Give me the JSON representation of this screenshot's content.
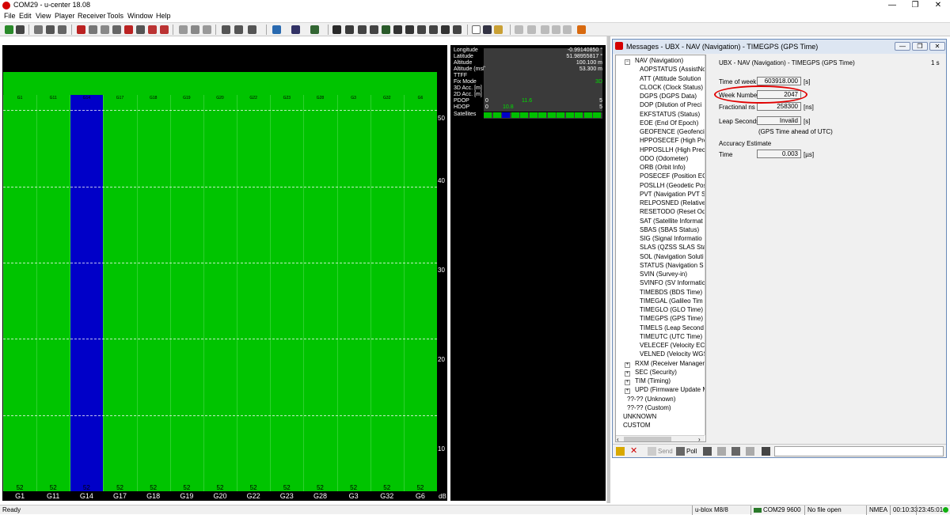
{
  "window": {
    "title": "COM29 - u-center 18.08",
    "minimize": "—",
    "restore": "❐",
    "close": "✕"
  },
  "menu": [
    "File",
    "Edit",
    "View",
    "Player",
    "Receiver",
    "Tools",
    "Window",
    "Help"
  ],
  "signal_chart": {
    "y_ticks": [
      "50",
      "40",
      "30",
      "20",
      "10"
    ],
    "unit": "dB",
    "satellites": [
      {
        "name": "G1",
        "cno": 52,
        "selected": false
      },
      {
        "name": "G11",
        "cno": 52,
        "selected": false
      },
      {
        "name": "G14",
        "cno": 52,
        "selected": true
      },
      {
        "name": "G17",
        "cno": 52,
        "selected": false
      },
      {
        "name": "G18",
        "cno": 52,
        "selected": false
      },
      {
        "name": "G19",
        "cno": 52,
        "selected": false
      },
      {
        "name": "G20",
        "cno": 52,
        "selected": false
      },
      {
        "name": "G22",
        "cno": 52,
        "selected": false
      },
      {
        "name": "G23",
        "cno": 52,
        "selected": false
      },
      {
        "name": "G28",
        "cno": 52,
        "selected": false
      },
      {
        "name": "G3",
        "cno": 52,
        "selected": false
      },
      {
        "name": "G32",
        "cno": 52,
        "selected": false
      },
      {
        "name": "G6",
        "cno": 52,
        "selected": false
      }
    ],
    "colors": {
      "bar": "#00c400",
      "selected_bar": "#0000c8",
      "background": "#000000"
    }
  },
  "data_panel": {
    "longitude": {
      "label": "Longitude",
      "value": "-0.99140850 °"
    },
    "latitude": {
      "label": "Latitude",
      "value": "51.98955817 °"
    },
    "altitude": {
      "label": "Altitude",
      "value": "100.100 m"
    },
    "altitude_msl": {
      "label": "Altitude (msl)",
      "value": "53.300 m"
    },
    "ttff": {
      "label": "TTFF",
      "value": ""
    },
    "fix_mode": {
      "label": "Fix Mode",
      "value": "3D"
    },
    "acc3d": {
      "label": "3D Acc. [m]",
      "value": ""
    },
    "acc2d": {
      "label": "2D Acc. [m]",
      "value": ""
    },
    "pdop": {
      "label": "PDOP",
      "min": "0",
      "value": "11.6",
      "max": "5"
    },
    "hdop": {
      "label": "HDOP",
      "min": "0",
      "value": "10.8",
      "max": "5"
    },
    "satellites": {
      "label": "Satellites"
    }
  },
  "messages_window": {
    "title": "Messages - UBX - NAV (Navigation) - TIMEGPS (GPS Time)",
    "header": "UBX - NAV (Navigation) - TIMEGPS (GPS Time)",
    "rate": "1 s",
    "tree": [
      {
        "label": "NAV (Navigation)",
        "level": 0,
        "expanded": true
      },
      {
        "label": "AOPSTATUS (AssistNo",
        "level": 1
      },
      {
        "label": "ATT (Attitude Solution",
        "level": 1
      },
      {
        "label": "CLOCK (Clock Status)",
        "level": 1
      },
      {
        "label": "DGPS (DGPS Data)",
        "level": 1
      },
      {
        "label": "DOP (Dilution of Preci",
        "level": 1
      },
      {
        "label": "EKFSTATUS (Status)",
        "level": 1
      },
      {
        "label": "EOE (End Of Epoch)",
        "level": 1
      },
      {
        "label": "GEOFENCE (Geofencin",
        "level": 1
      },
      {
        "label": "HPPOSECEF (High Pre",
        "level": 1
      },
      {
        "label": "HPPOSLLH (High Prec",
        "level": 1
      },
      {
        "label": "ODO (Odometer)",
        "level": 1
      },
      {
        "label": "ORB (Orbit Info)",
        "level": 1
      },
      {
        "label": "POSECEF (Position ECI",
        "level": 1
      },
      {
        "label": "POSLLH (Geodetic Pos",
        "level": 1
      },
      {
        "label": "PVT (Navigation PVT S",
        "level": 1
      },
      {
        "label": "RELPOSNED (Relative I",
        "level": 1
      },
      {
        "label": "RESETODO (Reset Odo",
        "level": 1
      },
      {
        "label": "SAT (Satellite Informat",
        "level": 1
      },
      {
        "label": "SBAS (SBAS Status)",
        "level": 1
      },
      {
        "label": "SIG (Signal Informatio",
        "level": 1
      },
      {
        "label": "SLAS (QZSS SLAS Statu",
        "level": 1
      },
      {
        "label": "SOL (Navigation Soluti",
        "level": 1
      },
      {
        "label": "STATUS (Navigation S",
        "level": 1
      },
      {
        "label": "SVIN (Survey-in)",
        "level": 1
      },
      {
        "label": "SVINFO (SV Informatic",
        "level": 1
      },
      {
        "label": "TIMEBDS (BDS Time)",
        "level": 1
      },
      {
        "label": "TIMEGAL (Galileo Tim",
        "level": 1
      },
      {
        "label": "TIMEGLO (GLO Time)",
        "level": 1
      },
      {
        "label": "TIMEGPS (GPS Time)",
        "level": 1,
        "selected": true
      },
      {
        "label": "TIMELS (Leap Second",
        "level": 1
      },
      {
        "label": "TIMEUTC (UTC Time)",
        "level": 1
      },
      {
        "label": "VELECEF (Velocity ECE",
        "level": 1
      },
      {
        "label": "VELNED (Velocity WGS",
        "level": 1
      },
      {
        "label": "RXM (Receiver Manager)",
        "level": 0,
        "expanded": false
      },
      {
        "label": "SEC (Security)",
        "level": 0,
        "expanded": false
      },
      {
        "label": "TIM (Timing)",
        "level": 0,
        "expanded": false
      },
      {
        "label": "UPD (Firmware Update M",
        "level": 0,
        "expanded": false
      },
      {
        "label": "??-?? (Unknown)",
        "level": 0
      },
      {
        "label": "??-?? (Custom)",
        "level": 0
      },
      {
        "label": "UNKNOWN",
        "level": -1
      },
      {
        "label": "CUSTOM",
        "level": -1
      }
    ],
    "fields": {
      "time_of_week": {
        "label": "Time of week",
        "value": "603918.000",
        "unit": "[s]"
      },
      "week_number": {
        "label": "Week Number",
        "value": "2047"
      },
      "fractional": {
        "label": "Fractional ns",
        "value": "258300",
        "unit": "[ns]"
      },
      "leap_seconds": {
        "label": "Leap Seconds",
        "value": "Invalid",
        "unit": "[s]"
      },
      "leap_note": "(GPS Time ahead of UTC)",
      "accuracy_heading": "Accuracy Estimate",
      "time_acc": {
        "label": "Time",
        "value": "0.003",
        "unit": "[µs]"
      }
    },
    "toolbar": {
      "send": "Send",
      "poll": "Poll"
    }
  },
  "status_bar": {
    "ready": "Ready",
    "receiver": "u-blox M8/8",
    "port": "COM29 9600",
    "file": "No file open",
    "protocol": "NMEA",
    "elapsed": "00:10:33",
    "clock": "23:45:01"
  }
}
